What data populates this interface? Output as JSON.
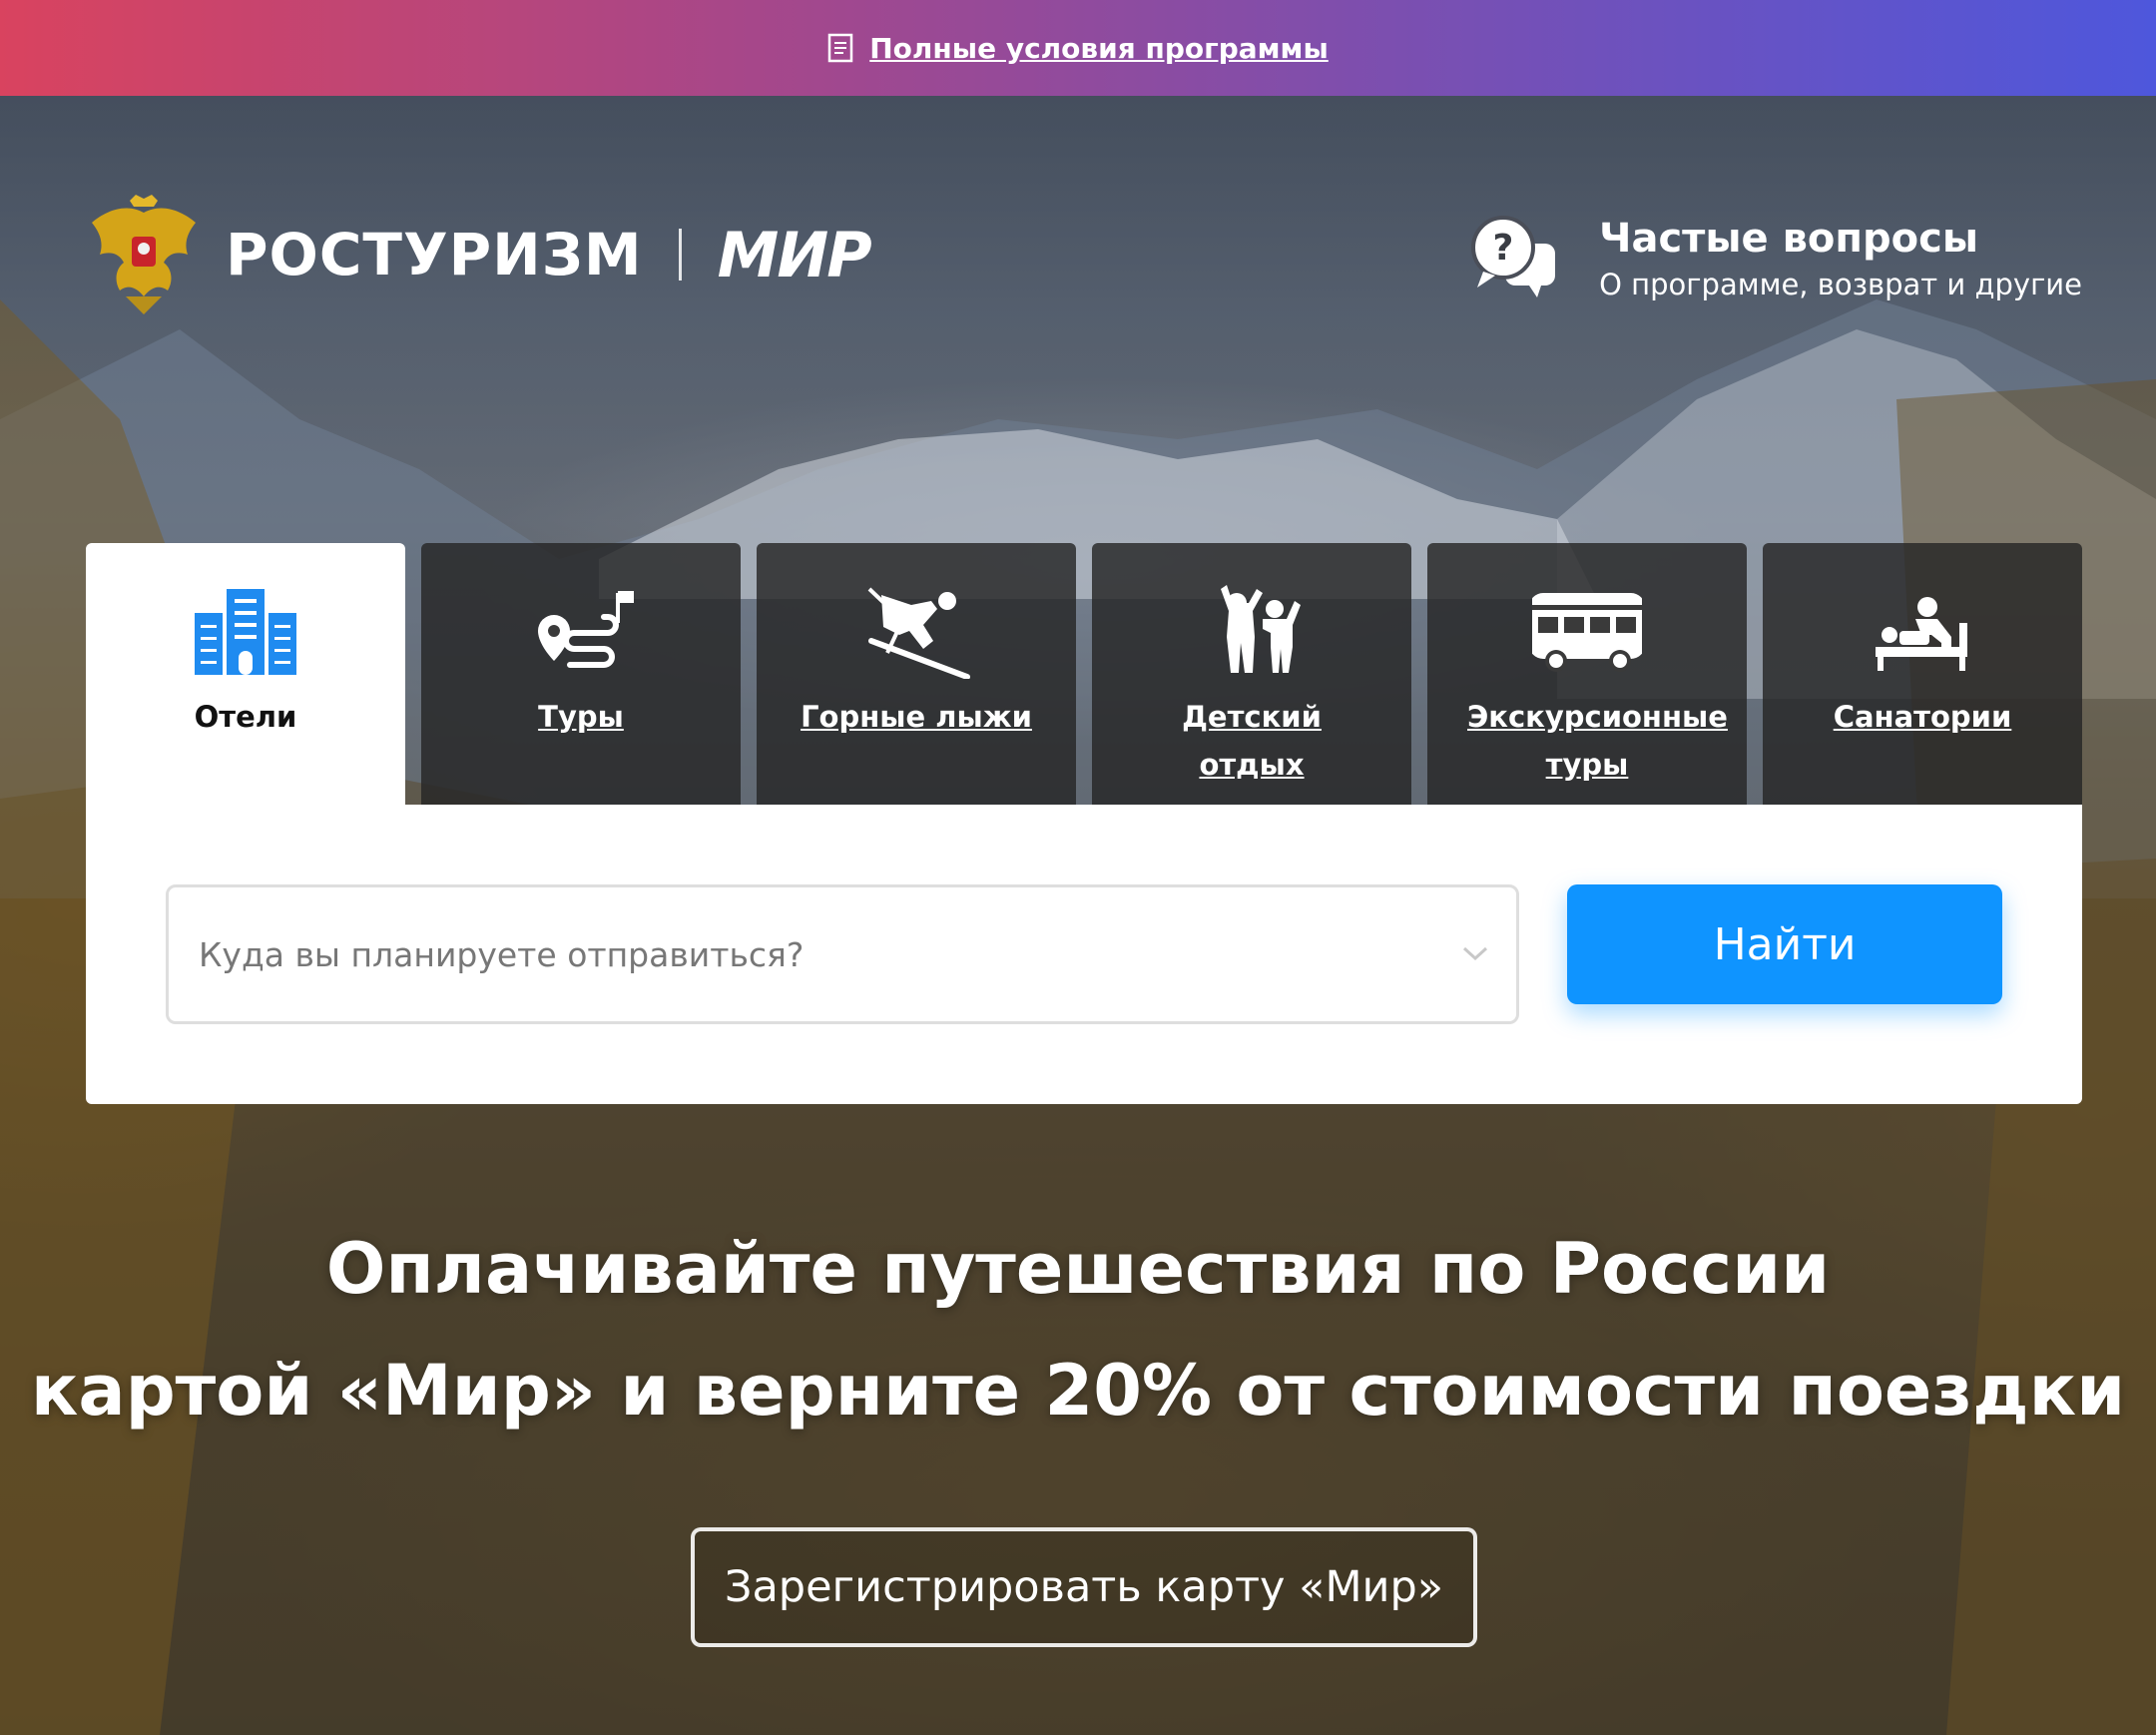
{
  "banner": {
    "link_label": "Полные условия программы",
    "icon": "document-icon"
  },
  "header": {
    "brand_name": "РОСТУРИЗМ",
    "partner_name": "МИР",
    "emblem": "coat-of-arms-icon",
    "faq": {
      "title": "Частые вопросы",
      "subtitle": "О программе, возврат и другие",
      "icon": "question-chat-icon"
    }
  },
  "tabs": [
    {
      "label": "Отели",
      "icon": "hotel-icon",
      "active": true
    },
    {
      "label": "Туры",
      "icon": "route-icon",
      "active": false
    },
    {
      "label": "Горные лыжи",
      "icon": "skier-icon",
      "active": false
    },
    {
      "label": "Детский отдых",
      "icon": "children-icon",
      "active": false
    },
    {
      "label": "Экскурсионные туры",
      "icon": "bus-icon",
      "active": false
    },
    {
      "label": "Санатории",
      "icon": "massage-icon",
      "active": false
    }
  ],
  "search": {
    "placeholder": "Куда вы планируете отправиться?",
    "button_label": "Найти"
  },
  "hero": {
    "line1": "Оплачивайте путешествия по России",
    "line2": "картой «Мир» и верните 20% от стоимости поездки",
    "register_label": "Зарегистрировать карту «Мир»"
  },
  "colors": {
    "accent": "#0f94ff",
    "banner_start": "#d9435f",
    "banner_end": "#4e57dc",
    "hotel_icon": "#1f8bf0"
  }
}
